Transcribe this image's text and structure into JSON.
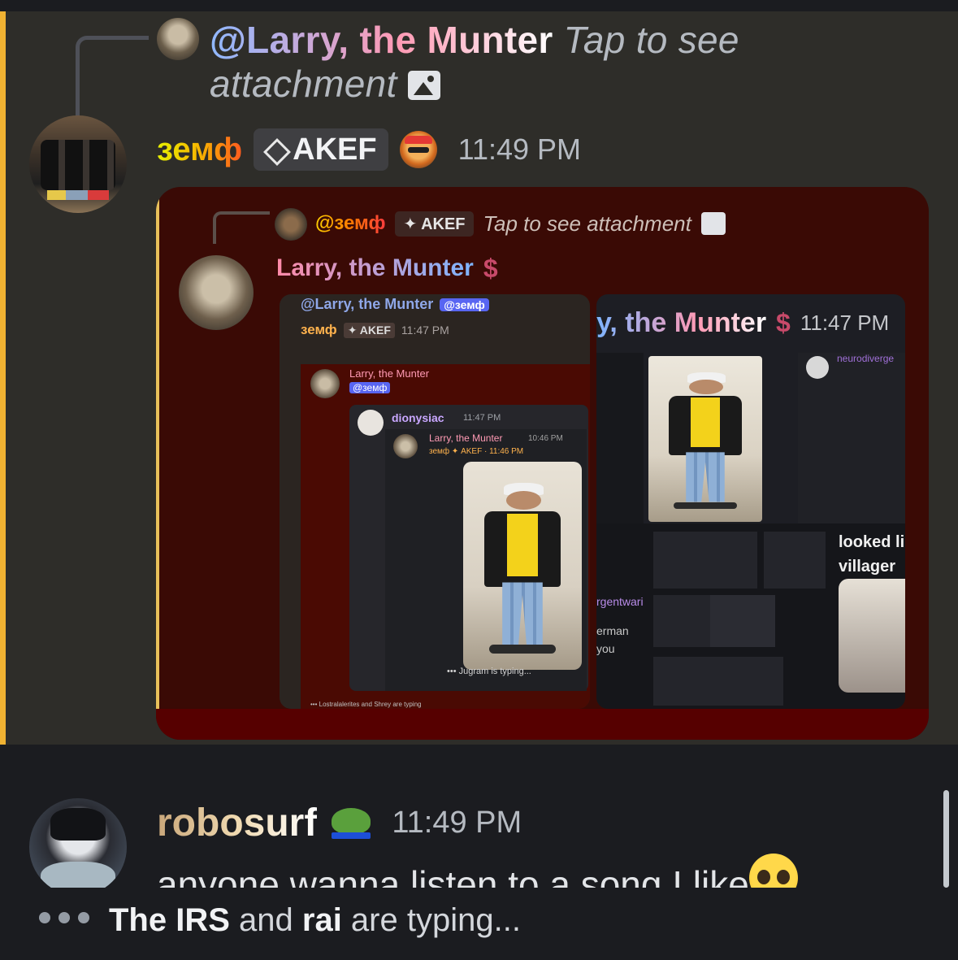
{
  "reply": {
    "mention": "@Larry, the Munter",
    "attachment_text": "Tap to see",
    "attachment_text2": "attachment",
    "icon": "image-icon"
  },
  "message1": {
    "username": "земф",
    "badge": "AKEF",
    "badge_icon": "diamond-icon",
    "time": "11:49 PM"
  },
  "embedded": {
    "reply_mention": "@земф",
    "reply_badge": "AKEF",
    "reply_attachment": "Tap to see attachment",
    "author": "Larry, the Munter",
    "author_icon": "dollar-icon",
    "author_symbol": "$",
    "left": {
      "row1_mention": "@Larry, the Munter",
      "row1_chip": "@земф",
      "user": "земф",
      "badge": "AKEF",
      "time": "11:47 PM",
      "inner_name": "Larry, the Munter",
      "inner_chip": "@земф",
      "dion_name": "dionysiac",
      "dion_time": "11:47 PM",
      "panel_name": "Larry, the Munter",
      "panel_time": "10:46 PM",
      "panel_sub": "земф ✦ AKEF · 11:46 PM",
      "typing": "Jugram is typing...",
      "typing2": "Lostralalerites and Shrey are typing"
    },
    "right": {
      "title": "y, the Munter",
      "title_symbol": "$",
      "time": "11:47 PM",
      "side_name": "neurodiverge",
      "looked": "looked li",
      "villager": "villager",
      "frag1": "rgentwari",
      "frag2": "erman",
      "frag3": "you"
    }
  },
  "message2": {
    "username": "robosurf",
    "emoji": "frog-icon",
    "time": "11:49 PM",
    "text": "anyone wanna listen to a song I like",
    "trailing_emoji": "pleading-face-icon"
  },
  "typing": {
    "user1": "The IRS",
    "mid": " and ",
    "user2": "rai",
    "tail": " are typing..."
  },
  "colors": {
    "mention_highlight": "#f0b232",
    "message_bg": "#2e2d29",
    "app_bg": "#1b1c20"
  }
}
